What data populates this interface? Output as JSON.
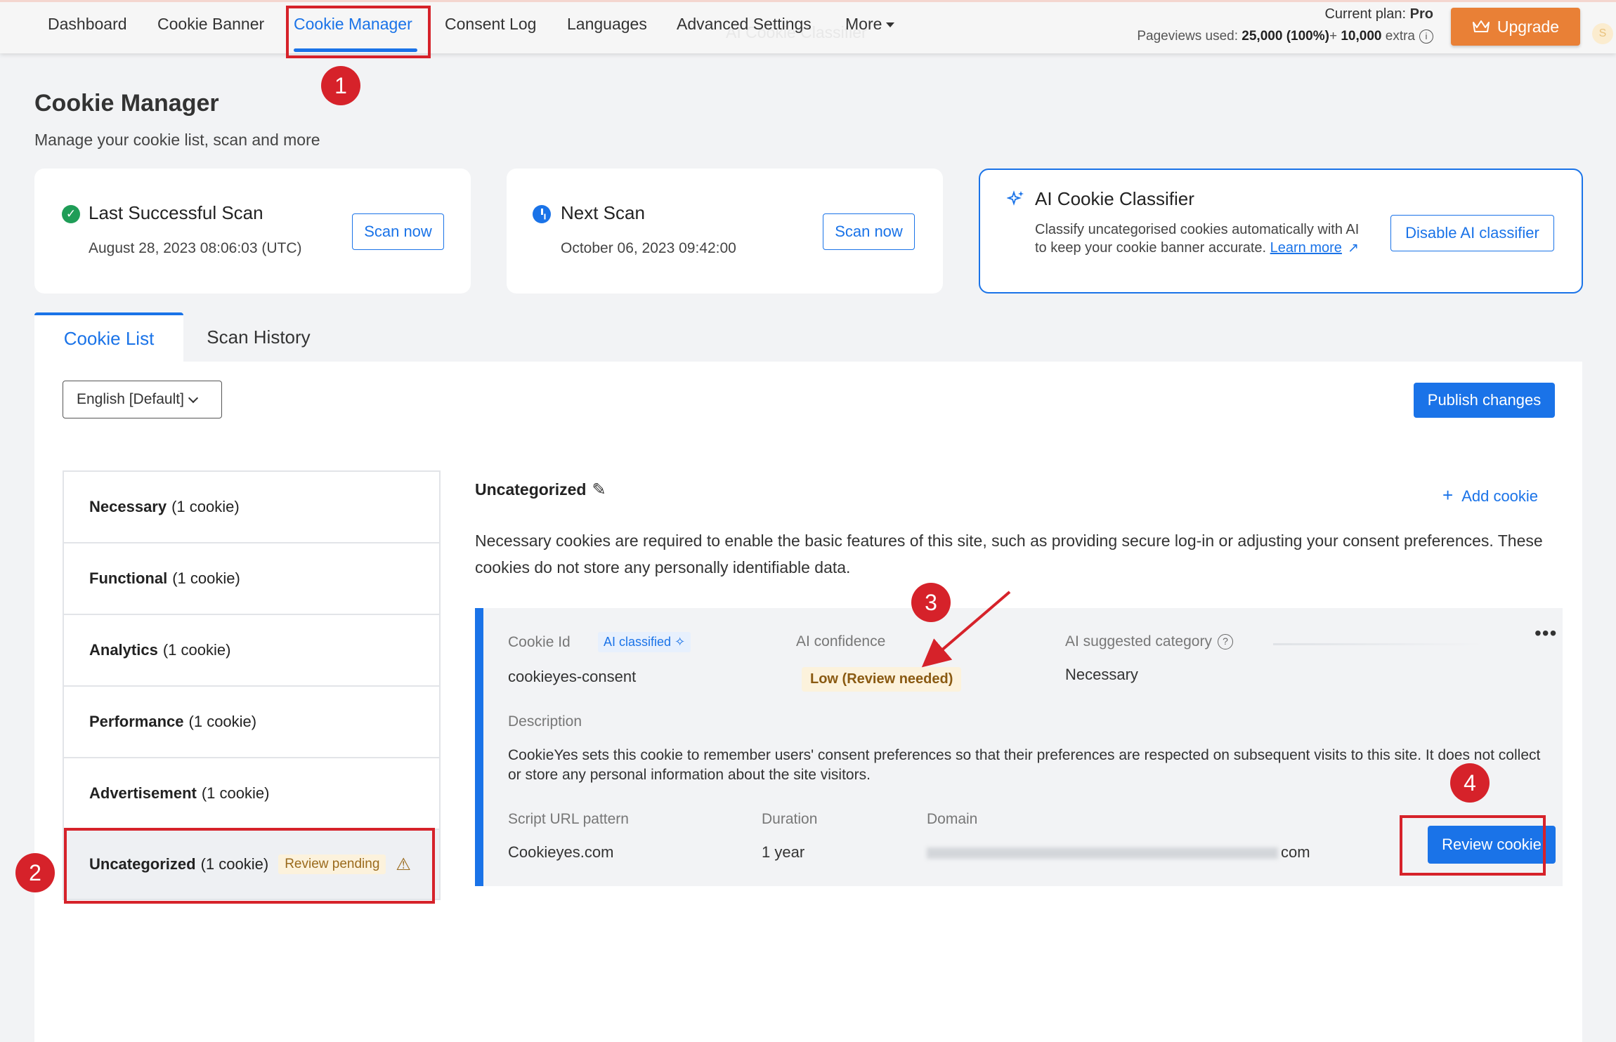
{
  "nav": {
    "items": [
      "Dashboard",
      "Cookie Banner",
      "Cookie Manager",
      "Consent Log",
      "Languages",
      "Advanced Settings"
    ],
    "more_label": "More",
    "ghost_label": "AI Cookie Classifier",
    "plan_prefix": "Current plan:",
    "plan_name": "Pro",
    "pageviews_prefix": "Pageviews used:",
    "pageviews_used": "25,000 (100%)",
    "pageviews_extra_prefix": "+",
    "pageviews_extra": "10,000",
    "pageviews_extra_suffix": "extra",
    "upgrade_label": "Upgrade",
    "avatar_letter": "S"
  },
  "header": {
    "title": "Cookie Manager",
    "subtitle": "Manage your cookie list, scan and more"
  },
  "cards": {
    "last_scan": {
      "title": "Last Successful Scan",
      "date": "August 28, 2023 08:06:03 (UTC)",
      "button": "Scan now"
    },
    "next_scan": {
      "title": "Next Scan",
      "date": "October 06, 2023 09:42:00",
      "button": "Scan now"
    },
    "ai_classifier": {
      "title": "AI Cookie Classifier",
      "description": "Classify uncategorised cookies automatically with AI to keep your cookie banner accurate.",
      "learn_more": "Learn more",
      "button": "Disable AI classifier"
    }
  },
  "tabs": [
    {
      "label": "Cookie List",
      "active": true
    },
    {
      "label": "Scan History",
      "active": false
    }
  ],
  "toolbar": {
    "language": "English [Default]",
    "publish_label": "Publish changes"
  },
  "categories": [
    {
      "name": "Necessary",
      "count": "(1 cookie)"
    },
    {
      "name": "Functional",
      "count": "(1 cookie)"
    },
    {
      "name": "Analytics",
      "count": "(1 cookie)"
    },
    {
      "name": "Performance",
      "count": "(1 cookie)"
    },
    {
      "name": "Advertisement",
      "count": "(1 cookie)"
    },
    {
      "name": "Uncategorized",
      "count": "(1 cookie)",
      "badge": "Review pending",
      "selected": true
    }
  ],
  "detail": {
    "title": "Uncategorized",
    "add_cookie_label": "Add cookie",
    "description": "Necessary cookies are required to enable the basic features of this site, such as providing secure log-in or adjusting your consent preferences. These cookies do not store any personally identifiable data."
  },
  "cookie": {
    "id_label": "Cookie Id",
    "ai_classified_label": "AI classified",
    "id_value": "cookieyes-consent",
    "confidence_label": "AI confidence",
    "confidence_value": "Low (Review needed)",
    "suggested_label": "AI suggested category",
    "suggested_value": "Necessary",
    "description_label": "Description",
    "description_value": "CookieYes sets this cookie to remember users' consent preferences so that their preferences are respected on subsequent visits to this site. It does not collect or store any personal information about the site visitors.",
    "script_label": "Script URL pattern",
    "script_value": "Cookieyes.com",
    "duration_label": "Duration",
    "duration_value": "1 year",
    "domain_label": "Domain",
    "domain_value_suffix": "com",
    "review_label": "Review cookie"
  },
  "annotations": [
    "1",
    "2",
    "3",
    "4"
  ],
  "colors": {
    "accent": "#1a73e8",
    "upgrade": "#e98036",
    "annotation_red": "#d6222a",
    "success": "#1f9d57",
    "warning_bg": "#fcf2dc"
  }
}
